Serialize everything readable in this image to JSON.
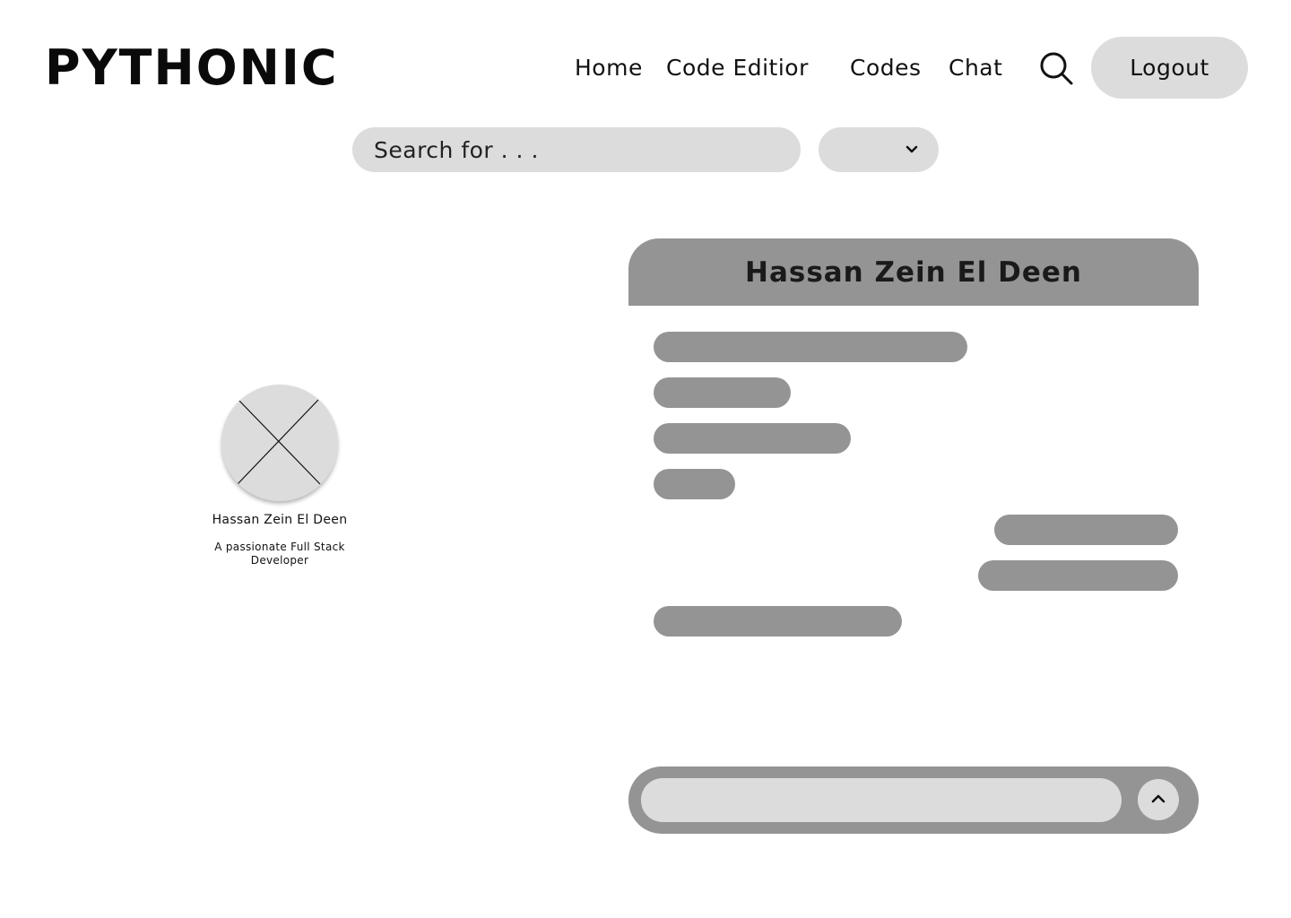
{
  "brand": {
    "logo_text": "PYTHONIC"
  },
  "nav": {
    "links": [
      {
        "label": "Home"
      },
      {
        "label": "Code Editior"
      },
      {
        "label": "Codes"
      },
      {
        "label": "Chat"
      }
    ],
    "search_icon": "search-icon",
    "logout_label": "Logout"
  },
  "search": {
    "placeholder": "Search for . . .",
    "filter_icon": "chevron-down-icon"
  },
  "profile": {
    "avatar_icon": "image-placeholder-icon",
    "name": "Hassan Zein El Deen",
    "bio": "A passionate Full Stack Developer"
  },
  "chat": {
    "title": "Hassan Zein El Deen",
    "messages": [
      {
        "side": "received"
      },
      {
        "side": "received"
      },
      {
        "side": "received"
      },
      {
        "side": "received"
      },
      {
        "side": "sent"
      },
      {
        "side": "sent"
      },
      {
        "side": "received"
      }
    ],
    "composer": {
      "value": "",
      "send_icon": "chevron-up-icon"
    }
  },
  "colors": {
    "light_gray": "#dcdcdc",
    "mid_gray": "#949494",
    "text": "#111111",
    "background": "#ffffff"
  }
}
